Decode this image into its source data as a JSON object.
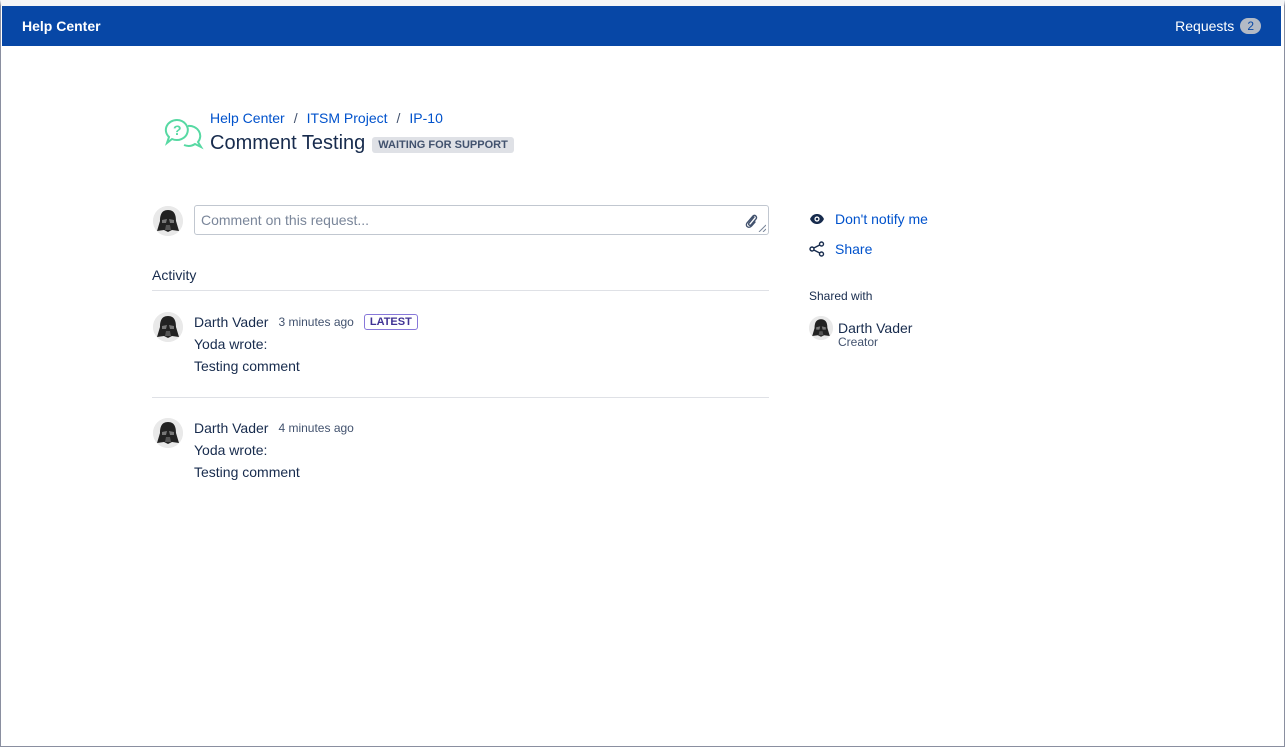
{
  "topbar": {
    "brand": "Help Center",
    "requests_label": "Requests",
    "requests_count": "2",
    "bg_color": "#0747a6"
  },
  "breadcrumb": [
    "Help Center",
    "ITSM Project",
    "IP-10"
  ],
  "breadcrumb_separator": "/",
  "request": {
    "title": "Comment Testing",
    "status": "WAITING FOR SUPPORT"
  },
  "comment": {
    "placeholder": "Comment on this request..."
  },
  "activity": {
    "heading": "Activity",
    "items": [
      {
        "author": "Darth Vader",
        "time": "3 minutes ago",
        "badge": "LATEST",
        "line1": "Yoda wrote:",
        "line2": "Testing comment"
      },
      {
        "author": "Darth Vader",
        "time": "4 minutes ago",
        "line1": "Yoda wrote:",
        "line2": "Testing comment"
      }
    ]
  },
  "sidebar": {
    "notify_label": "Don't notify me",
    "share_label": "Share",
    "shared_with_heading": "Shared with",
    "shared_user": {
      "name": "Darth Vader",
      "role": "Creator"
    }
  },
  "icons": {
    "help": "help-center-icon",
    "notify": "eye-icon",
    "share": "share-icon",
    "attach": "paperclip-icon"
  }
}
